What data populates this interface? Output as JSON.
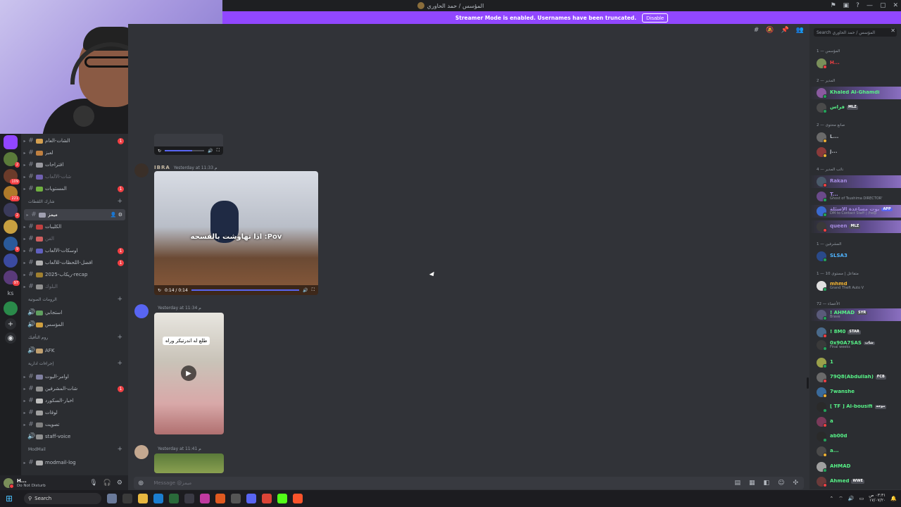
{
  "window": {
    "title": "المؤسس / حمد الحاوري",
    "controls": [
      "⚑",
      "▣",
      "?",
      "—",
      "▢",
      "✕"
    ]
  },
  "streamer_banner": {
    "message": "Streamer Mode is enabled. Usernames have been truncated.",
    "button": "Disable"
  },
  "servers": {
    "badges": [
      "2",
      "109",
      "221",
      "2",
      "9",
      "97"
    ],
    "text_server": "ks"
  },
  "channels": [
    {
      "label": "الشات-العام",
      "unread": "1",
      "type": "text"
    },
    {
      "label": "لعبز",
      "type": "text"
    },
    {
      "label": "اقتراحات",
      "type": "text"
    },
    {
      "label": "شات-الألعاب",
      "type": "text",
      "muted": true
    },
    {
      "label": "المستويات",
      "unread": "1",
      "type": "text"
    },
    {
      "category": "شارك اللقطات"
    },
    {
      "label": "ميمز",
      "type": "text",
      "active": true
    },
    {
      "label": "الكليبات",
      "type": "text"
    },
    {
      "label": "الفن",
      "type": "text",
      "muted": true
    },
    {
      "label": "اوسكات-الألعاب",
      "unread": "1",
      "type": "text"
    },
    {
      "label": "افضل-اللحظات-للألعاب",
      "unread": "1",
      "type": "text"
    },
    {
      "label": "2025-ريكاب-recap",
      "type": "text"
    },
    {
      "label": "البلوك",
      "type": "text",
      "muted": true
    },
    {
      "category": "الرومات الصوتية"
    },
    {
      "label": "استجابي",
      "type": "voice"
    },
    {
      "label": "المؤسس",
      "type": "voice"
    },
    {
      "category": "روم التأفيك"
    },
    {
      "label": "AFK",
      "type": "voice"
    },
    {
      "category": "إجراءات ادارية"
    },
    {
      "label": "اوامر-البوت",
      "type": "text"
    },
    {
      "label": "شات-المشرفين",
      "unread": "1",
      "type": "text"
    },
    {
      "label": "اخبار-السكورد",
      "type": "text"
    },
    {
      "label": "لوقات",
      "type": "text"
    },
    {
      "label": "تصويت",
      "type": "text"
    },
    {
      "label": "staff-voice",
      "type": "voice"
    },
    {
      "category": "ModMail"
    },
    {
      "label": "modmail-log",
      "type": "text"
    }
  ],
  "user_panel": {
    "name": "H...",
    "status": "Do Not Disturb"
  },
  "messages": [
    {
      "author": "IBRA",
      "time": "Yesterday at 11:33 م",
      "video": {
        "caption": "اذا تهاوشت بالفسحه :Pov",
        "time": "0:14 / 0:14",
        "progress": 1.0
      }
    },
    {
      "author": "",
      "time": "Yesterday at 11:34 م",
      "video": {
        "caption": "طلع له اندرتيكر وراه"
      }
    },
    {
      "author": "",
      "time": "Yesterday at 11:41 م"
    }
  ],
  "composer": {
    "placeholder": "Message @ميمز"
  },
  "member_search": {
    "placeholder": "Search المؤسس / حمد الحاوري"
  },
  "member_groups": [
    {
      "label": "المؤسس — 1"
    },
    {
      "label": "المدير — 2"
    },
    {
      "label": "صانع محتوى — 2"
    },
    {
      "label": "نائب المدير — 4"
    },
    {
      "label": "المشرفين — 1"
    },
    {
      "label": "متفاعل | مستوى 10 — 1"
    },
    {
      "label": "الأعضاء — 72"
    }
  ],
  "members": [
    {
      "name": "H...",
      "color": "#f23f43"
    },
    {
      "name": "Khaled Al-Ghamdi",
      "color": "#57f287"
    },
    {
      "name": "فراس",
      "color": "#57f287",
      "tag": "MLZ"
    },
    {
      "name": "L...",
      "color": "#b5bac1"
    },
    {
      "name": "j...",
      "color": "#b5bac1"
    },
    {
      "name": "Rakan",
      "color": "#a58be0"
    },
    {
      "name": "T...",
      "color": "#a58be0",
      "activity": "Ghost of Tsushima DIRECTOR'"
    },
    {
      "name": "بوت مساعدة الأسئلة",
      "color": "#a58be0",
      "activity": "DM to Contact Staff | /help",
      "tag": "APP"
    },
    {
      "name": "queen",
      "color": "#a58be0",
      "tag": "MLZ"
    },
    {
      "name": "SLSA3",
      "color": "#4fb4ff"
    },
    {
      "name": "mhmd",
      "color": "#f0b232",
      "activity": "Grand Theft Auto V"
    },
    {
      "name": "! AHMAD",
      "color": "#57f287",
      "activity": "Brave",
      "tag": "SYR"
    },
    {
      "name": "! 8M0",
      "color": "#57f287",
      "tag": "STAR"
    },
    {
      "name": "0x90A7SAS",
      "color": "#57f287",
      "activity": "Final weeks",
      "tag": "شاب"
    },
    {
      "name": "1",
      "color": "#57f287"
    },
    {
      "name": "79Q8(Abdullah)",
      "color": "#57f287",
      "tag": "FCB"
    },
    {
      "name": "7wanshe",
      "color": "#57f287"
    },
    {
      "name": "[ TF ] Al-bousifi",
      "color": "#57f287",
      "tag": "موجه"
    },
    {
      "name": "a",
      "color": "#57f287"
    },
    {
      "name": "ab00d",
      "color": "#57f287"
    },
    {
      "name": "a...",
      "color": "#57f287"
    },
    {
      "name": "AHMAD",
      "color": "#57f287"
    },
    {
      "name": "Ahmed",
      "color": "#57f287",
      "tag": "WWE"
    }
  ],
  "taskbar": {
    "search": "Search",
    "time": "٠٣:٣١ ص",
    "date": "١٧/٠٧/٢٠"
  }
}
